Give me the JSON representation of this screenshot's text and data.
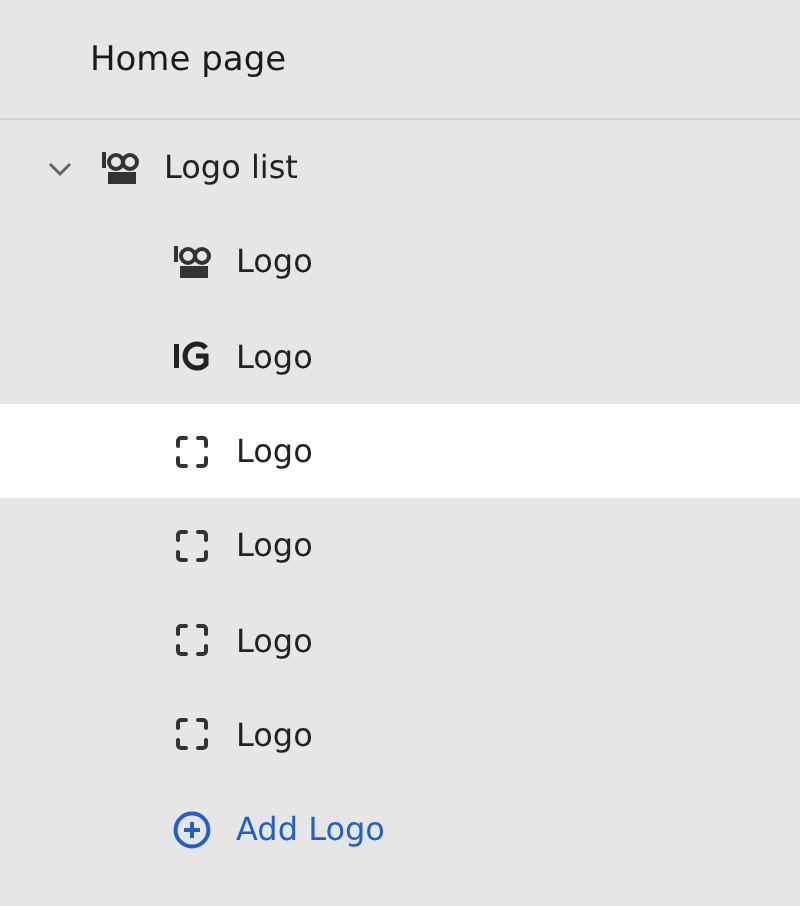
{
  "header": {
    "title": "Home page"
  },
  "tree": {
    "label": "Logo list",
    "expanded": true,
    "kind": "image_a",
    "children": [
      {
        "label": "Logo",
        "kind": "image_a",
        "selected": false
      },
      {
        "label": "Logo",
        "kind": "image_b",
        "selected": false
      },
      {
        "label": "Logo",
        "kind": "placeholder",
        "selected": true
      },
      {
        "label": "Logo",
        "kind": "placeholder",
        "selected": false
      },
      {
        "label": "Logo",
        "kind": "placeholder",
        "selected": false
      },
      {
        "label": "Logo",
        "kind": "placeholder",
        "selected": false
      }
    ]
  },
  "add_button": {
    "label": "Add Logo"
  }
}
